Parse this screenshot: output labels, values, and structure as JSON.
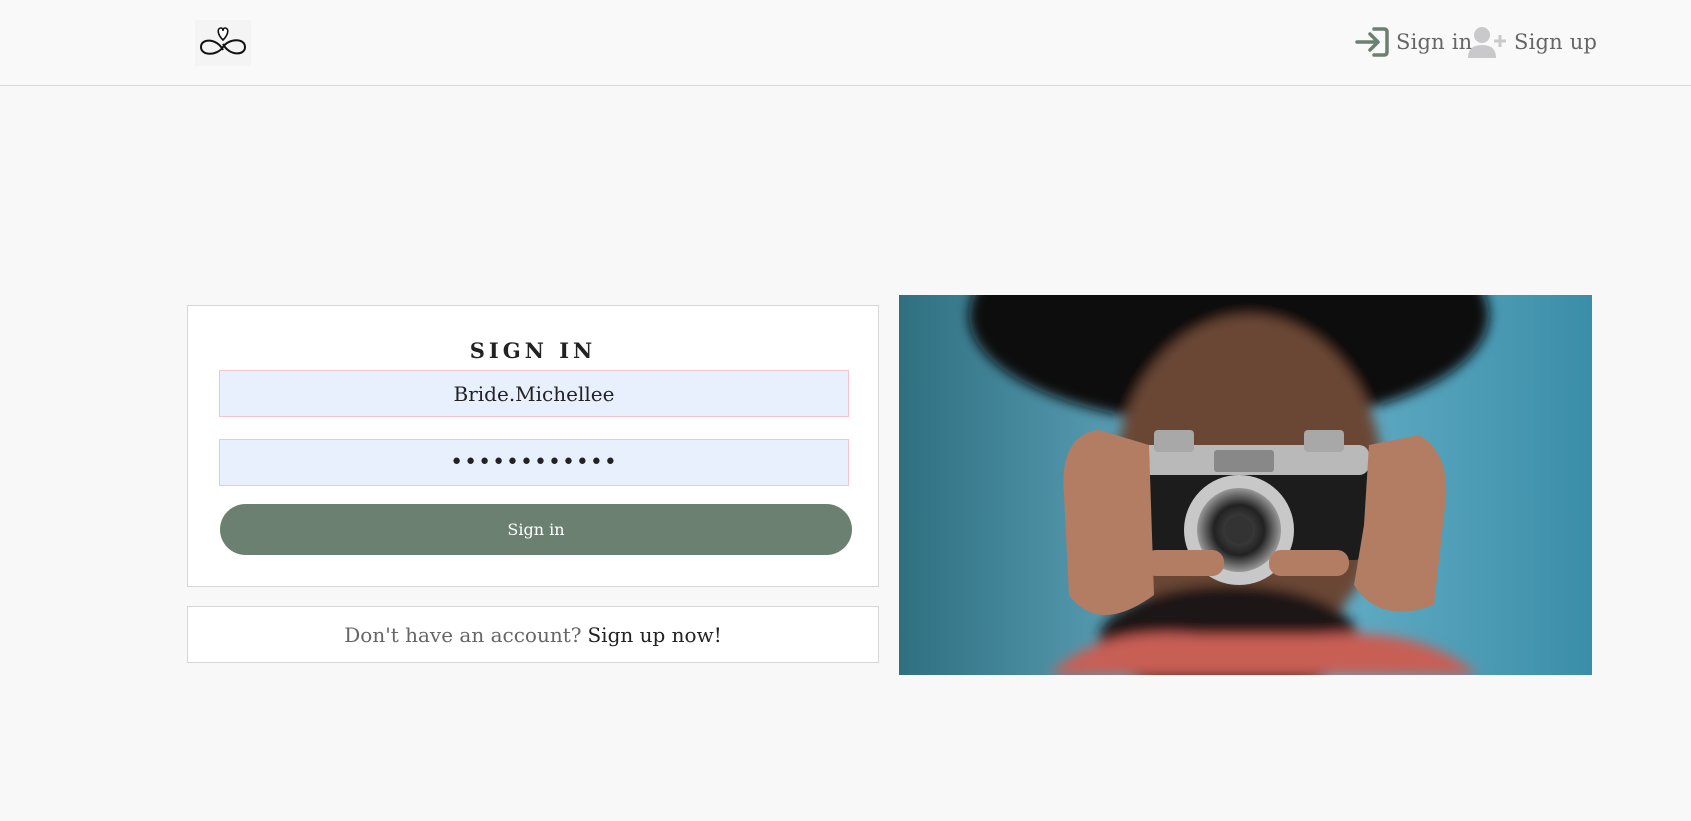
{
  "nav": {
    "logo_icon": "infinity-heart-logo",
    "signin_icon": "sign-in-arrow-icon",
    "signin_label": "Sign in",
    "signup_icon": "user-plus-icon",
    "signup_label": "Sign up"
  },
  "signin_form": {
    "title": "SIGN IN",
    "username_value": "Bride.Michellee",
    "password_value": "••••••••••••",
    "submit_label": "Sign in"
  },
  "signup_prompt": {
    "text": "Don't have an account?",
    "link": "Sign up now!"
  },
  "image": {
    "subject": "person-holding-camera-photo"
  },
  "colors": {
    "accent": "#6b8070",
    "background": "#f8f8f8",
    "field_fill": "#e8f0fe",
    "field_border": "#f4c6cc"
  }
}
